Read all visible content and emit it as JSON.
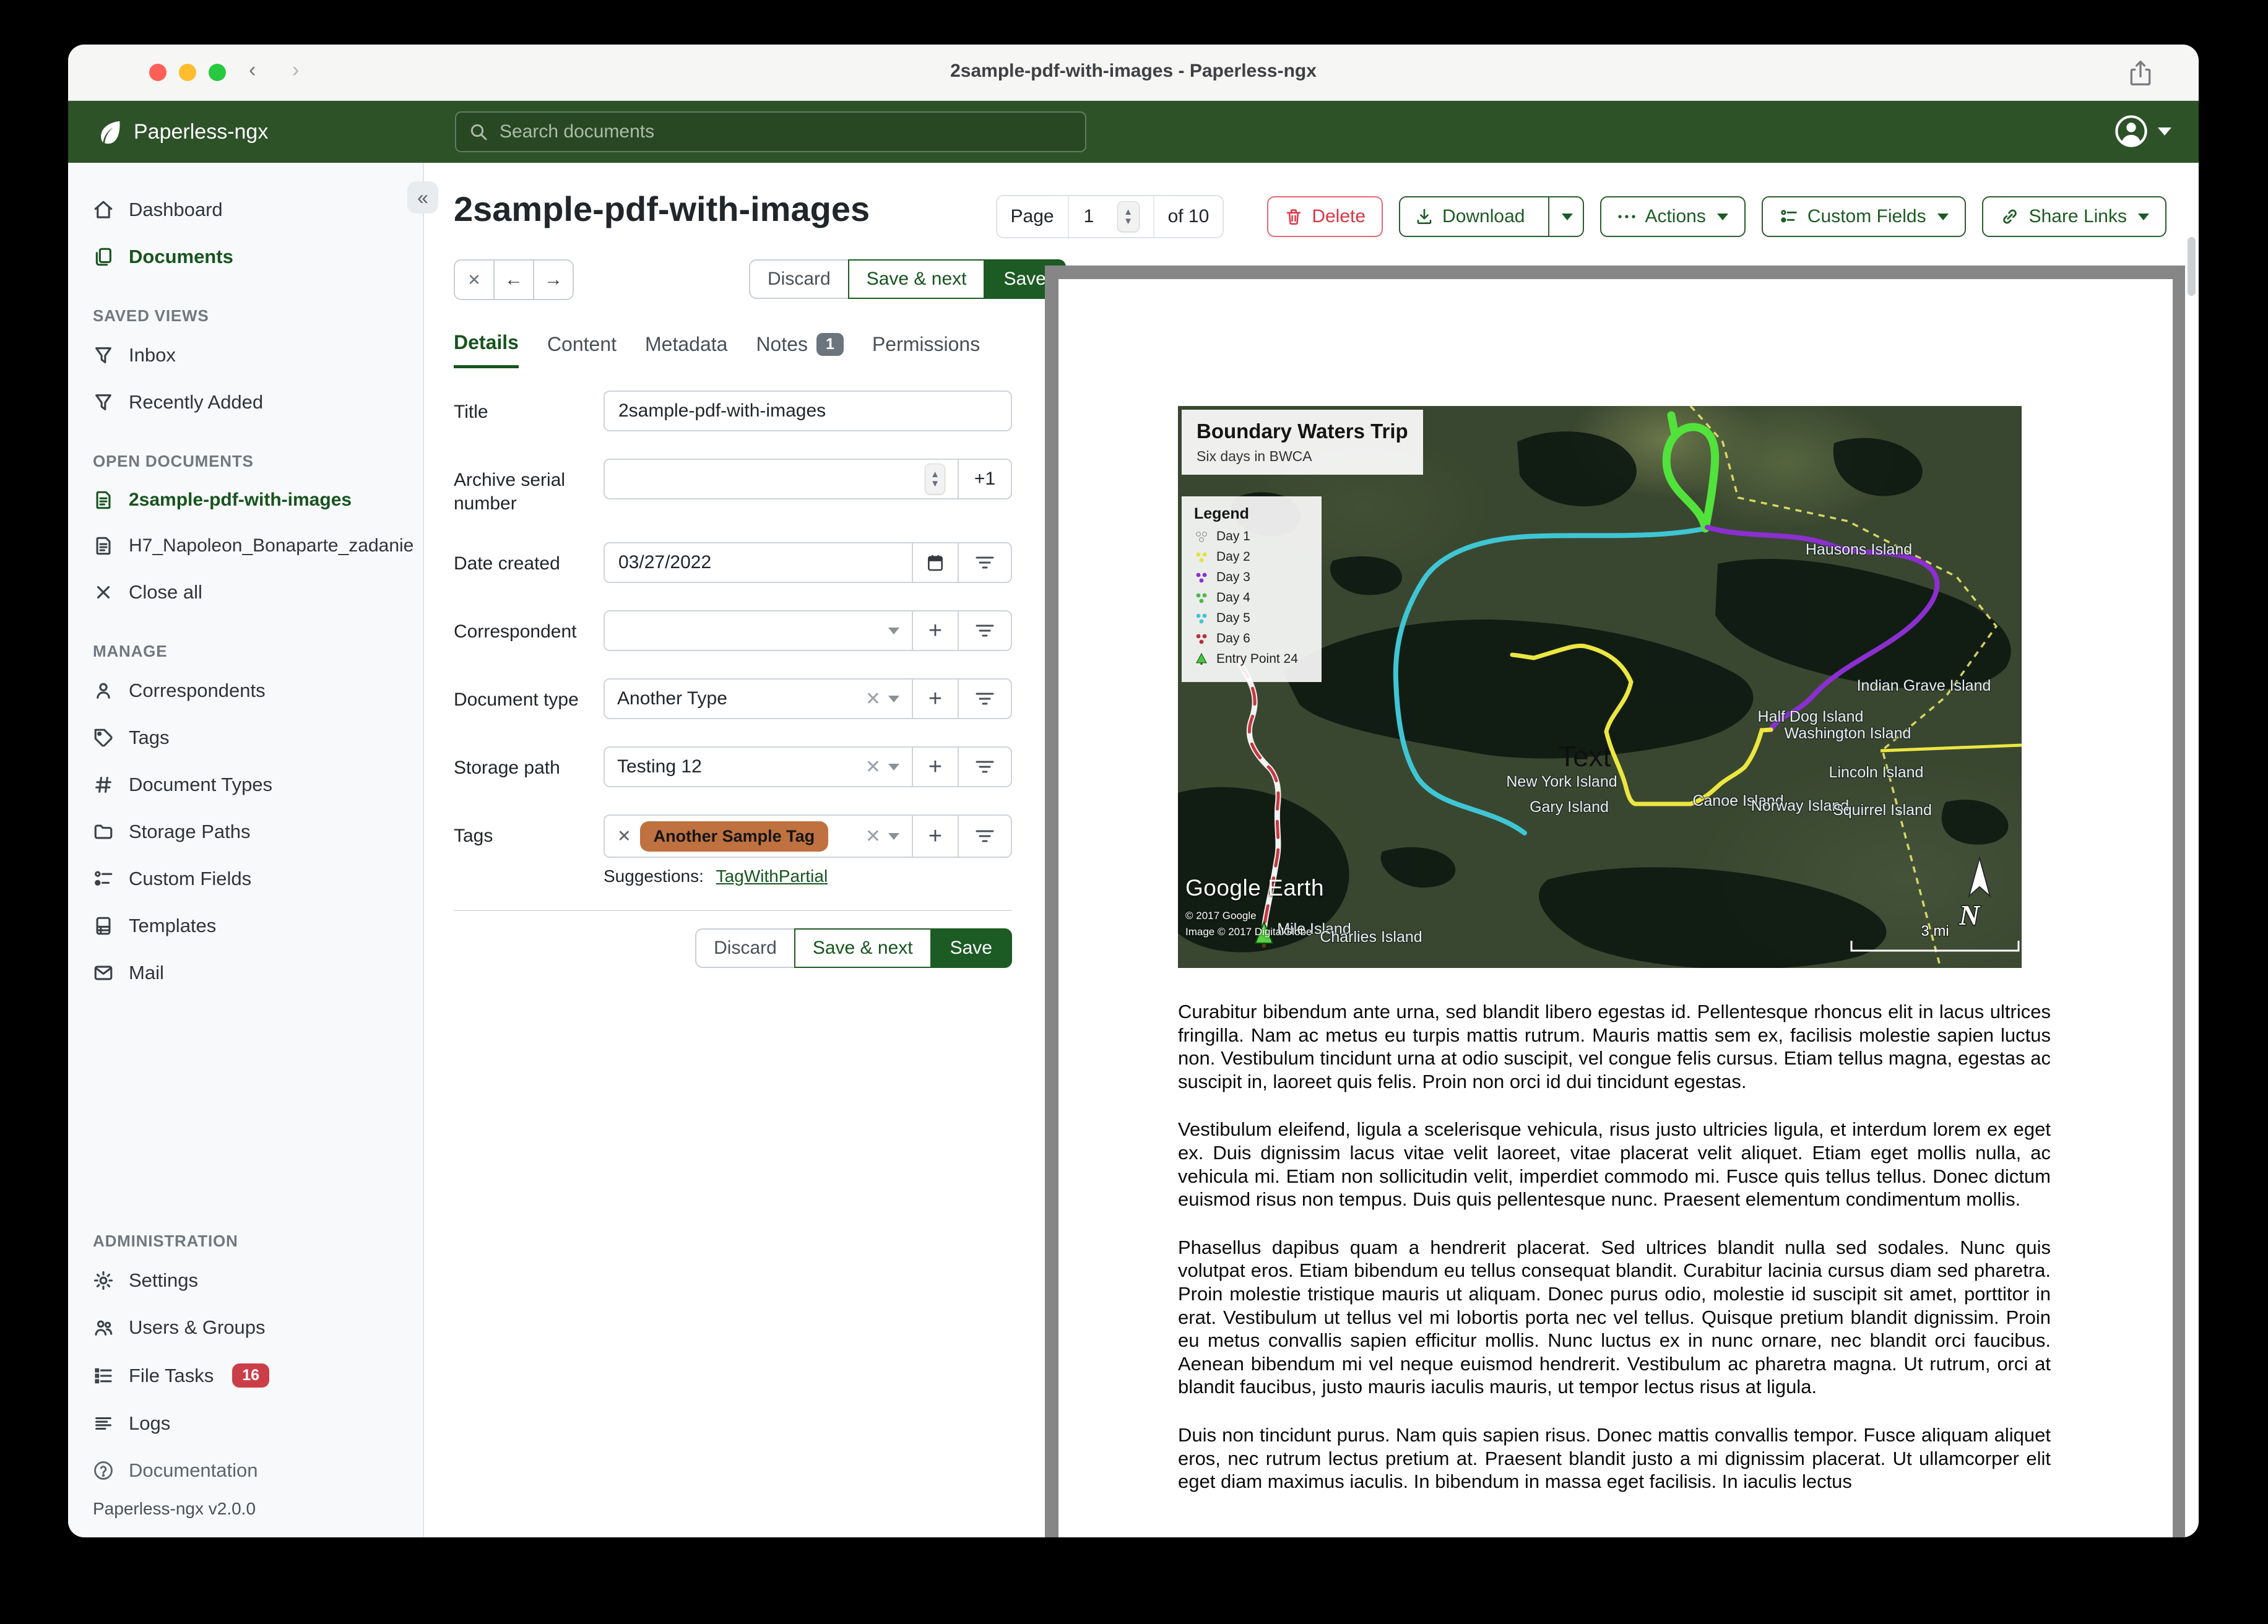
{
  "colors": {
    "accent_green": "#17541f",
    "header_green": "#2d5228",
    "save_button_green": "#1d5b24",
    "delete_red": "#dc3545",
    "tag_orange": "#bf7140",
    "file_tasks_badge_red": "#cb3e48"
  },
  "titlebar": {
    "title": "2sample-pdf-with-images - Paperless-ngx"
  },
  "app_header": {
    "brand": "Paperless-ngx",
    "search_placeholder": "Search documents"
  },
  "sidebar": {
    "dashboard": "Dashboard",
    "documents": "Documents",
    "saved_views": "SAVED VIEWS",
    "inbox": "Inbox",
    "recently_added": "Recently Added",
    "open_documents": "OPEN DOCUMENTS",
    "open_doc_1": "2sample-pdf-with-images",
    "open_doc_2": "H7_Napoleon_Bonaparte_zadanie",
    "close_all": "Close all",
    "manage": "MANAGE",
    "correspondents": "Correspondents",
    "tags": "Tags",
    "document_types": "Document Types",
    "storage_paths": "Storage Paths",
    "custom_fields": "Custom Fields",
    "templates": "Templates",
    "mail": "Mail",
    "administration": "ADMINISTRATION",
    "settings": "Settings",
    "users_groups": "Users & Groups",
    "file_tasks": "File Tasks",
    "file_tasks_badge": "16",
    "logs": "Logs",
    "documentation": "Documentation",
    "version": "Paperless-ngx v2.0.0"
  },
  "doc_header": {
    "title": "2sample-pdf-with-images",
    "page_label": "Page",
    "page_value": "1",
    "page_of": "of 10",
    "delete": "Delete",
    "download": "Download",
    "actions": "Actions",
    "custom_fields": "Custom Fields",
    "share_links": "Share Links",
    "discard": "Discard",
    "save_next": "Save & next",
    "save": "Save"
  },
  "tabs": {
    "details": "Details",
    "content": "Content",
    "metadata": "Metadata",
    "notes": "Notes",
    "notes_badge": "1",
    "permissions": "Permissions"
  },
  "form": {
    "title_label": "Title",
    "title_value": "2sample-pdf-with-images",
    "asn_label": "Archive serial number",
    "asn_add": "+1",
    "date_label": "Date created",
    "date_value": "03/27/2022",
    "correspondent_label": "Correspondent",
    "doctype_label": "Document type",
    "doctype_value": "Another Type",
    "storage_label": "Storage path",
    "storage_value": "Testing 12",
    "tags_label": "Tags",
    "tag_value": "Another Sample Tag",
    "suggestions_label": "Suggestions:",
    "suggestion_link": "TagWithPartial"
  },
  "map": {
    "title": "Boundary Waters Trip",
    "subtitle": "Six days in BWCA",
    "legend_title": "Legend",
    "legend": [
      {
        "label": "Day 1",
        "color": "#ececec"
      },
      {
        "label": "Day 2",
        "color": "#e2e23a"
      },
      {
        "label": "Day 3",
        "color": "#8b2fd0"
      },
      {
        "label": "Day 4",
        "color": "#4db84a"
      },
      {
        "label": "Day 5",
        "color": "#3fc6d4"
      },
      {
        "label": "Day 6",
        "color": "#b5323a"
      },
      {
        "label": "Entry Point 24",
        "color": "#46c93c"
      }
    ],
    "labels": {
      "hausons": "Hausons Island",
      "indian_grave": "Indian Grave Island",
      "half_dog": "Half Dog Island",
      "washington": "Washington Island",
      "lincoln": "Lincoln Island",
      "canoe": "Canoe Island",
      "norway": "Norway Island",
      "squirrel": "Squirrel Island",
      "new_york": "New York Island",
      "gary": "Gary Island",
      "mile": "Mile Island",
      "charlies": "Charlies Island"
    },
    "annotation": "Text",
    "compass": "N",
    "scale": "3 mi",
    "attribution_logo": "Google Earth",
    "attribution_1": "© 2017 Google",
    "attribution_2": "Image © 2017 DigitalGlobe"
  },
  "document_text": {
    "paragraphs": [
      "Curabitur bibendum ante urna, sed blandit libero egestas id. Pellentesque rhoncus elit in lacus ultrices fringilla. Nam ac metus eu turpis mattis rutrum. Mauris mattis sem ex, facilisis molestie sapien luctus non. Vestibulum tincidunt urna at odio suscipit, vel congue felis cursus. Etiam tellus magna, egestas ac suscipit in, laoreet quis felis. Proin non orci id dui tincidunt egestas.",
      "Vestibulum eleifend, ligula a scelerisque vehicula, risus justo ultricies ligula, et interdum lorem ex eget ex. Duis dignissim lacus vitae velit laoreet, vitae placerat velit aliquet. Etiam eget mollis nulla, ac vehicula mi. Etiam non sollicitudin velit, imperdiet commodo mi. Fusce quis tellus tellus. Donec dictum euismod risus non tempus. Duis quis pellentesque nunc. Praesent elementum condimentum mollis.",
      "Phasellus dapibus quam a hendrerit placerat. Sed ultrices blandit nulla sed sodales. Nunc quis volutpat eros. Etiam bibendum eu tellus consequat blandit. Curabitur lacinia cursus diam sed pharetra. Proin molestie tristique mauris ut aliquam. Donec purus odio, molestie id suscipit sit amet, porttitor in erat. Vestibulum ut tellus vel mi lobortis porta nec vel tellus. Quisque pretium blandit dignissim. Proin eu metus convallis sapien efficitur mollis. Nunc luctus ex in nunc ornare, nec blandit orci faucibus. Aenean bibendum mi vel neque euismod hendrerit. Vestibulum ac pharetra magna. Ut rutrum, orci at blandit faucibus, justo mauris iaculis mauris, ut tempor lectus risus at ligula.",
      "Duis non tincidunt purus. Nam quis sapien risus. Donec mattis convallis tempor. Fusce aliquam aliquet eros, nec rutrum lectus pretium at. Praesent blandit justo a mi dignissim placerat. Ut ullamcorper elit eget diam maximus iaculis. In bibendum in massa eget facilisis. In iaculis lectus"
    ]
  }
}
